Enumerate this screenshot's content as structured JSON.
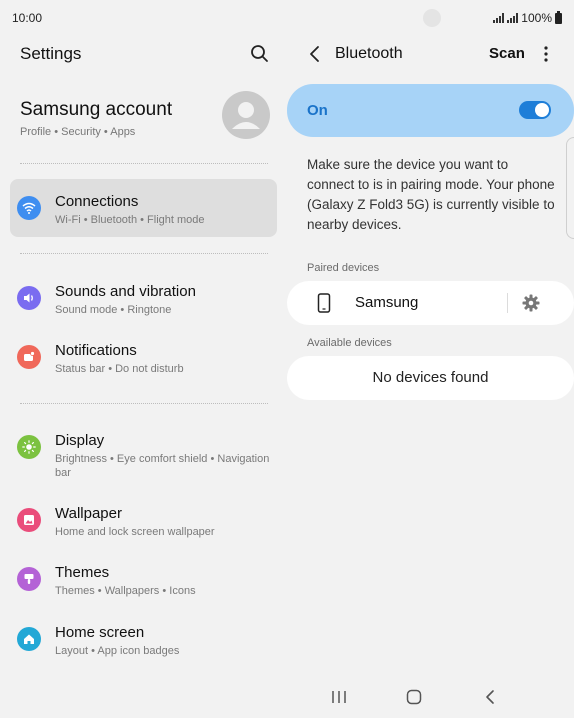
{
  "status_bar": {
    "time": "10:00",
    "battery": "100%",
    "icons": [
      "signal-icon",
      "signal-icon",
      "battery-icon"
    ]
  },
  "settings": {
    "title": "Settings",
    "search_icon": "search-icon",
    "account": {
      "name": "Samsung account",
      "subtitle": "Profile  •  Security  •  Apps"
    },
    "items": [
      {
        "id": "connections",
        "title": "Connections",
        "subtitle": "Wi-Fi  •  Bluetooth  •  Flight mode",
        "icon": "wifi-icon",
        "color": "#3f8ef0",
        "active": true
      },
      {
        "id": "sounds",
        "title": "Sounds and vibration",
        "subtitle": "Sound mode  •  Ringtone",
        "icon": "volume-icon",
        "color": "#7a6cf0"
      },
      {
        "id": "notifications",
        "title": "Notifications",
        "subtitle": "Status bar  •  Do not disturb",
        "icon": "notification-icon",
        "color": "#f0685a"
      },
      {
        "id": "display",
        "title": "Display",
        "subtitle": "Brightness  •  Eye comfort shield  •  Navigation bar",
        "icon": "sun-icon",
        "color": "#7cc240"
      },
      {
        "id": "wallpaper",
        "title": "Wallpaper",
        "subtitle": "Home and lock screen wallpaper",
        "icon": "image-icon",
        "color": "#ea4d7b"
      },
      {
        "id": "themes",
        "title": "Themes",
        "subtitle": "Themes  •  Wallpapers  •  Icons",
        "icon": "brush-icon",
        "color": "#b462d6"
      },
      {
        "id": "home",
        "title": "Home screen",
        "subtitle": "Layout  •  App icon badges",
        "icon": "home-icon",
        "color": "#23a8d6"
      }
    ]
  },
  "bluetooth": {
    "title": "Bluetooth",
    "scan_label": "Scan",
    "toggle_label": "On",
    "toggle_on": true,
    "description": "Make sure the device you want to connect to is in pairing mode. Your phone (Galaxy Z Fold3 5G) is currently visible to nearby devices.",
    "paired_label": "Paired devices",
    "paired_devices": [
      {
        "name": "Samsung",
        "icon": "phone-icon"
      }
    ],
    "available_label": "Available devices",
    "available_empty": "No devices found"
  },
  "nav": {
    "buttons": [
      "recents-icon",
      "home-icon",
      "back-icon"
    ]
  },
  "colors": {
    "accent": "#1e7ed8",
    "toggle_card": "#a7d3f7"
  }
}
